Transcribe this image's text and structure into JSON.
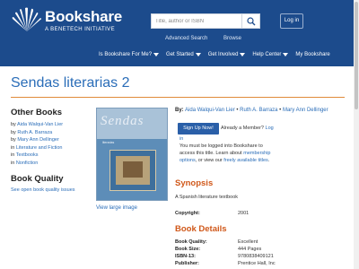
{
  "header": {
    "brand": "Bookshare",
    "tagline": "A BENETECH INITIATIVE",
    "search_placeholder": "Title, author or ISBN",
    "login_label": "Log in",
    "sub_links": [
      "Advanced Search",
      "Browse"
    ],
    "nav": [
      "Is Bookshare For Me?",
      "Get Started",
      "Get Involved",
      "Help Center",
      "My Bookshare"
    ]
  },
  "page": {
    "title": "Sendas literarias 2"
  },
  "other_books": {
    "heading": "Other Books",
    "items": [
      {
        "prefix": "by ",
        "link": "Aida Walqui-Van Lier"
      },
      {
        "prefix": "by ",
        "link": "Ruth A. Barraza"
      },
      {
        "prefix": "by ",
        "link": "Mary Ann Dellinger"
      },
      {
        "prefix": "in ",
        "link": "Literature and Fiction"
      },
      {
        "prefix": "in ",
        "link": "Textbooks"
      },
      {
        "prefix": "in ",
        "link": "Nonfiction"
      }
    ]
  },
  "book_quality": {
    "heading": "Book Quality",
    "link": "See open book quality issues"
  },
  "cover": {
    "title": "Sendas",
    "subtitle": "literarias",
    "view_large": "View large image"
  },
  "authors": {
    "label": "By:",
    "names": [
      "Aida Walqui-Van Lier",
      "Ruth A. Barraza",
      "Mary Ann Dellinger"
    ],
    "separator": " • "
  },
  "access": {
    "signup_label": "Sign Up Now!",
    "already_member": "Already a Member?",
    "login_link": "Log",
    "login_link_cont": "in",
    "msg_line1": "You must be logged into Bookshare to",
    "msg_line2_pre": "access this title. Learn about ",
    "msg_line2_link": "membership",
    "msg_line3_link1": "options",
    "msg_line3_mid": ", or view our ",
    "msg_line3_link2": "freely available titles",
    "msg_line3_end": "."
  },
  "synopsis": {
    "heading": "Synopsis",
    "text": "A Spanish literature textbook",
    "copyright_label": "Copyright:",
    "copyright_value": "2001"
  },
  "details": {
    "heading": "Book Details",
    "rows": [
      {
        "label": "Book Quality:",
        "value": "Excellent"
      },
      {
        "label": "Book Size:",
        "value": "444 Pages"
      },
      {
        "label": "ISBN-13:",
        "value": "9780838409121"
      },
      {
        "label": "Publisher:",
        "value": "Prentice Hall, Inc"
      }
    ]
  },
  "colors": {
    "header_bg": "#1c4b8c",
    "link": "#2a6db8",
    "section_heading": "#d0581a",
    "title_rule": "#e08a3a"
  }
}
